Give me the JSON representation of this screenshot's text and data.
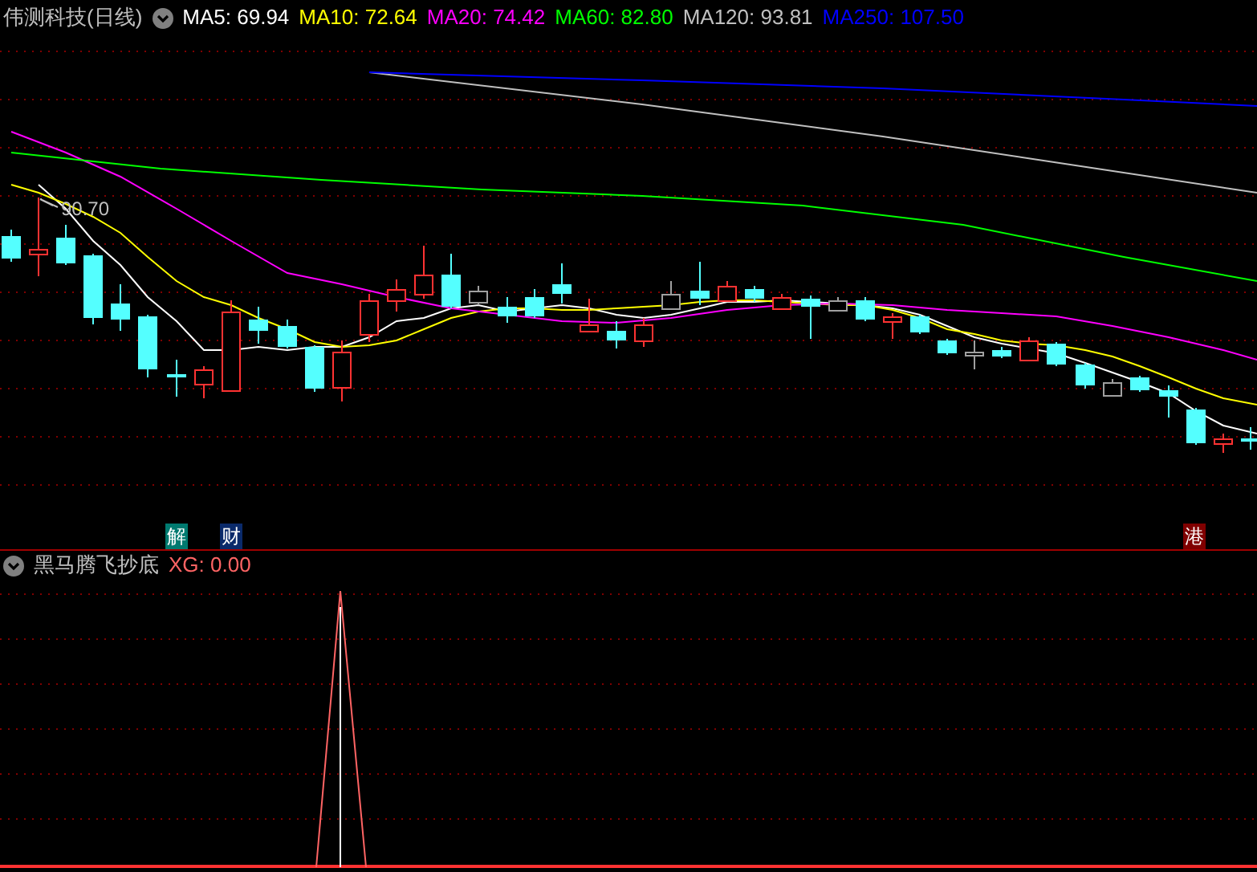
{
  "main_panel": {
    "title": "伟测科技(日线)",
    "moving_averages": [
      {
        "label": "MA5: 69.94",
        "color": "#ffffff"
      },
      {
        "label": "MA10: 72.64",
        "color": "#ffff00"
      },
      {
        "label": "MA20: 74.42",
        "color": "#ff00ff"
      },
      {
        "label": "MA60: 82.80",
        "color": "#00ff00"
      },
      {
        "label": "MA120: 93.81",
        "color": "#c0c0c0"
      },
      {
        "label": "MA250: 107.50",
        "color": "#0000ff"
      }
    ],
    "high_marker": "90.70",
    "event_markers": [
      {
        "label": "解",
        "color": "#007a70"
      },
      {
        "label": "财",
        "color": "#0a2a6a"
      },
      {
        "label": "港",
        "color": "#800000"
      }
    ]
  },
  "indicator_panel": {
    "title": "黑马腾飞抄底",
    "reading": "XG: 0.00"
  }
}
